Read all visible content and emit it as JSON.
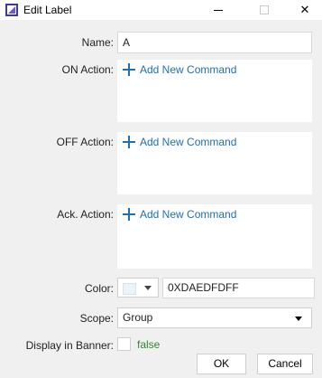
{
  "window": {
    "title": "Edit Label",
    "minimize_glyph": "—",
    "maximize_glyph": "☐",
    "close_glyph": "✕"
  },
  "form": {
    "name_label": "Name:",
    "name_value": "A",
    "on_action_label": "ON Action:",
    "off_action_label": "OFF Action:",
    "ack_action_label": "Ack. Action:",
    "add_command_label": "Add New Command",
    "color_label": "Color:",
    "color_value": "0XDAEDFDFF",
    "scope_label": "Scope:",
    "scope_value": "Group",
    "display_in_banner_label": "Display in Banner:",
    "display_in_banner_value": "false"
  },
  "buttons": {
    "ok": "OK",
    "cancel": "Cancel"
  },
  "colors": {
    "swatch": "#edf3fb",
    "link": "#1e6fb8",
    "false_text": "#2a8a2a"
  },
  "icons": {
    "app": "app-logo-icon",
    "add": "plus-icon",
    "dropdown": "chevron-down-icon"
  }
}
